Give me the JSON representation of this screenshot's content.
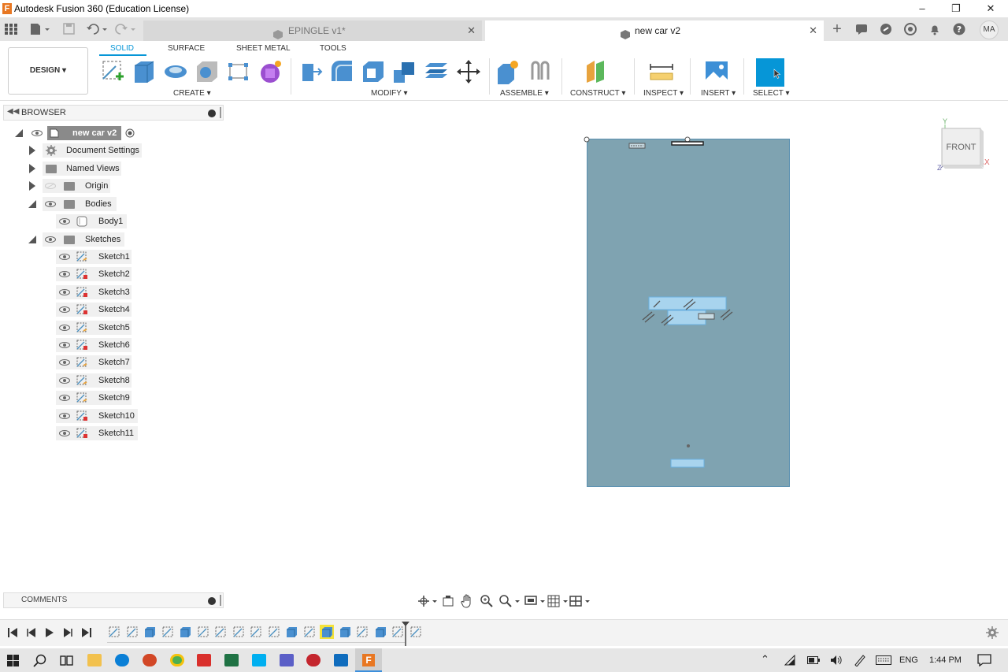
{
  "window": {
    "title": "Autodesk Fusion 360 (Education License)",
    "app_logo": "F",
    "controls": [
      "minimize-icon",
      "restore-icon",
      "close-icon"
    ]
  },
  "tabs": [
    {
      "label": "EPINGLE v1*",
      "active": false
    },
    {
      "label": "new car v2",
      "active": true
    }
  ],
  "profile_initials": "MA",
  "toolbar": {
    "workspace_button": "DESIGN",
    "workspace_tabs": [
      "SOLID",
      "SURFACE",
      "SHEET METAL",
      "TOOLS"
    ],
    "active_workspace_tab": "SOLID",
    "groups": [
      "CREATE",
      "MODIFY",
      "ASSEMBLE",
      "CONSTRUCT",
      "INSPECT",
      "INSERT",
      "SELECT"
    ]
  },
  "browser": {
    "title": "BROWSER",
    "root": "new car v2",
    "items": [
      {
        "label": "Document Settings"
      },
      {
        "label": "Named Views"
      },
      {
        "label": "Origin"
      },
      {
        "label": "Bodies"
      },
      {
        "label": "Body1"
      },
      {
        "label": "Sketches"
      }
    ],
    "sketches": [
      "Sketch1",
      "Sketch2",
      "Sketch3",
      "Sketch4",
      "Sketch5",
      "Sketch6",
      "Sketch7",
      "Sketch8",
      "Sketch9",
      "Sketch10",
      "Sketch11"
    ]
  },
  "viewcube": {
    "face": "FRONT",
    "axis_y": "Y",
    "axis_x": "X",
    "axis_z": "Z"
  },
  "comments": {
    "title": "COMMENTS"
  },
  "taskbar": {
    "language": "ENG",
    "time": "1:44 PM"
  },
  "colors": {
    "accent": "#0696d7",
    "plate": "#7fa3b1",
    "select_button": "#0696d7"
  }
}
